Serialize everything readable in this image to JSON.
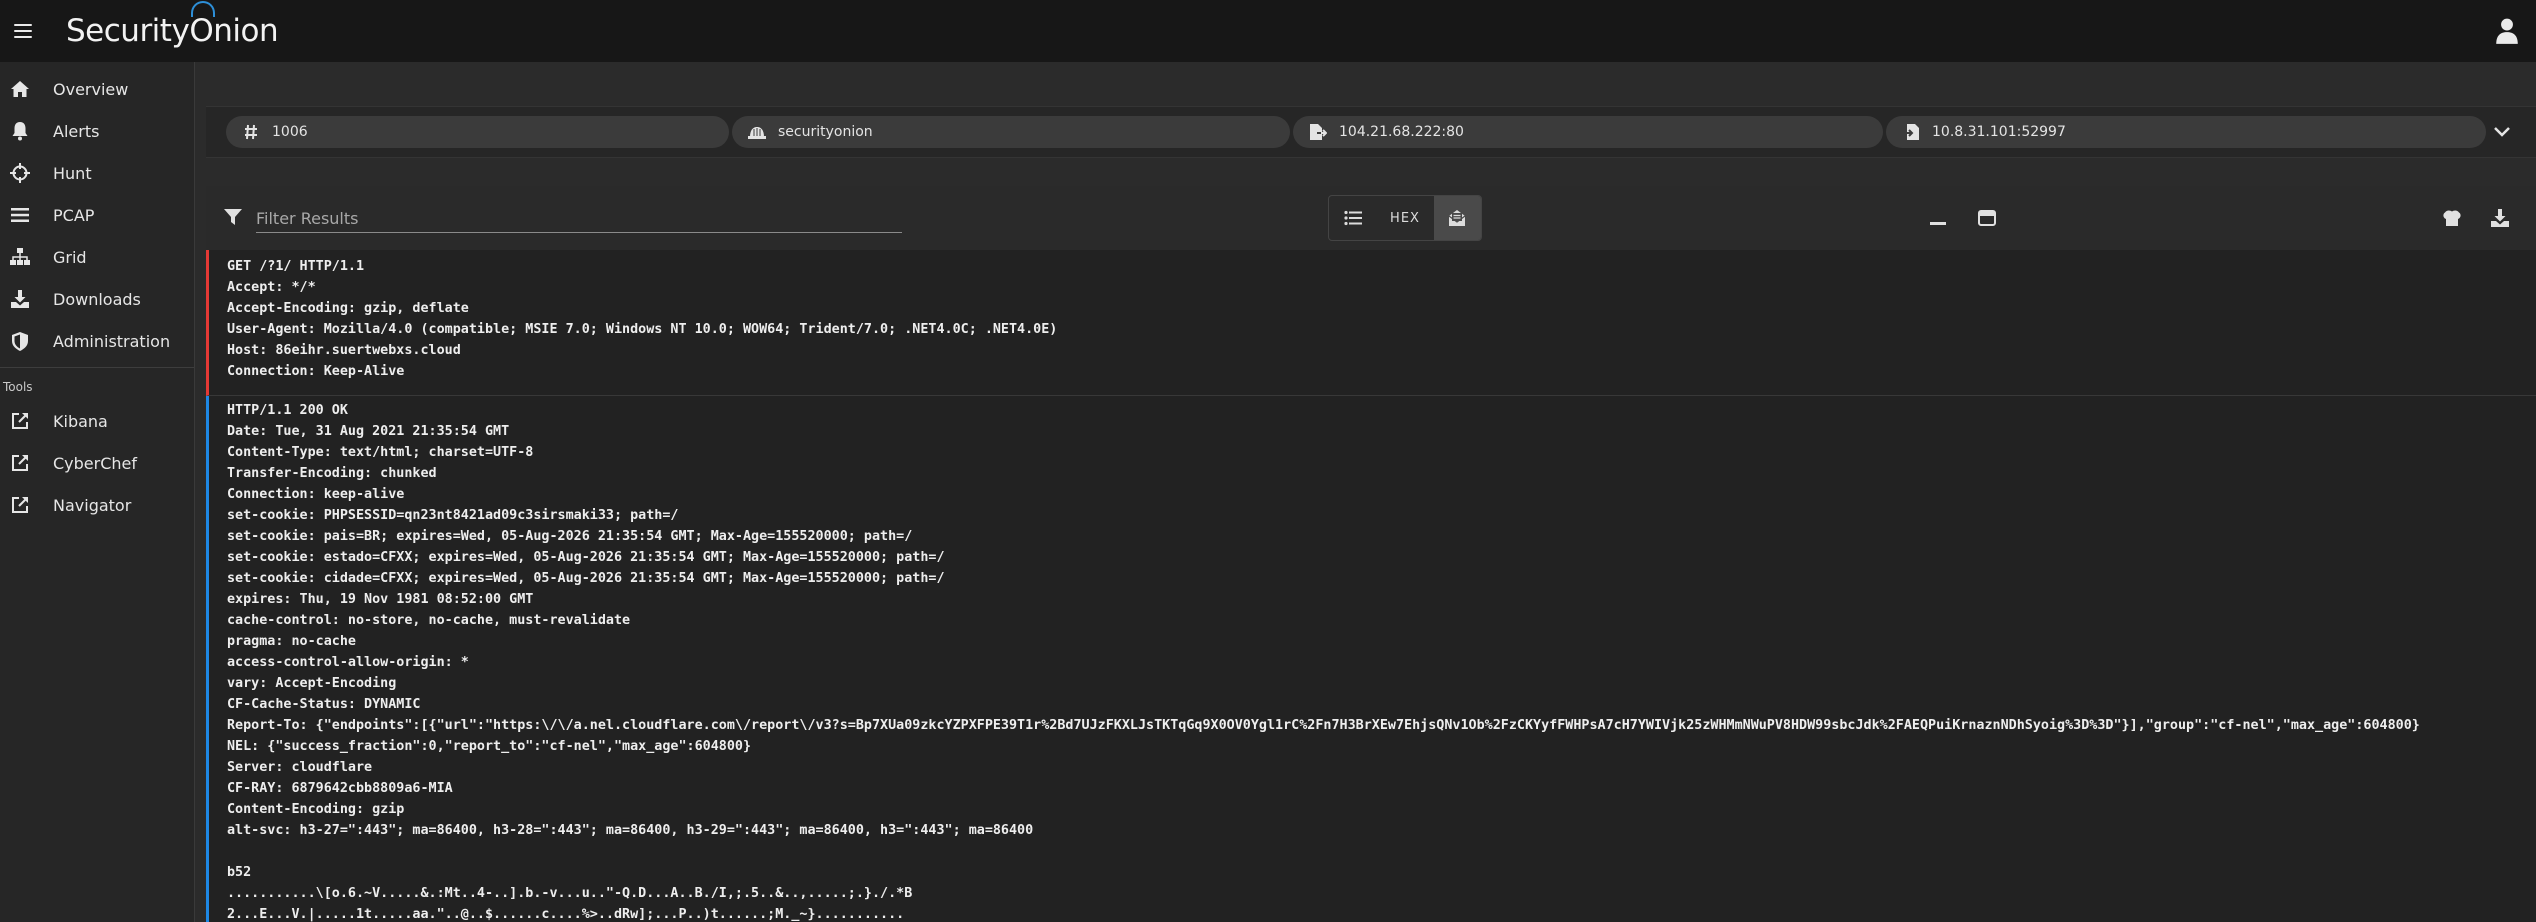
{
  "app": {
    "logo_text_a": "Security",
    "logo_text_o": "O",
    "logo_text_b": "nion"
  },
  "sidebar": {
    "items": [
      {
        "label": "Overview",
        "icon": "home-icon"
      },
      {
        "label": "Alerts",
        "icon": "bell-icon"
      },
      {
        "label": "Hunt",
        "icon": "crosshairs-icon"
      },
      {
        "label": "PCAP",
        "icon": "bars-icon"
      },
      {
        "label": "Grid",
        "icon": "sitemap-icon"
      },
      {
        "label": "Downloads",
        "icon": "download-icon"
      },
      {
        "label": "Administration",
        "icon": "shield-icon"
      }
    ],
    "tools_label": "Tools",
    "tools": [
      {
        "label": "Kibana",
        "icon": "external-link-icon"
      },
      {
        "label": "CyberChef",
        "icon": "external-link-icon"
      },
      {
        "label": "Navigator",
        "icon": "external-link-icon"
      }
    ]
  },
  "filters": {
    "id": "1006",
    "sensor": "securityonion",
    "destination": "104.21.68.222:80",
    "source": "10.8.31.101:52997"
  },
  "toolbar": {
    "filter_placeholder": "Filter Results",
    "hex_label": "HEX"
  },
  "stream": {
    "client_lines": [
      "GET /?1/ HTTP/1.1",
      "Accept: */*",
      "Accept-Encoding: gzip, deflate",
      "User-Agent: Mozilla/4.0 (compatible; MSIE 7.0; Windows NT 10.0; WOW64; Trident/7.0; .NET4.0C; .NET4.0E)",
      "Host: 86eihr.suertwebxs.cloud",
      "Connection: Keep-Alive"
    ],
    "server_lines": [
      "HTTP/1.1 200 OK",
      "Date: Tue, 31 Aug 2021 21:35:54 GMT",
      "Content-Type: text/html; charset=UTF-8",
      "Transfer-Encoding: chunked",
      "Connection: keep-alive",
      "set-cookie: PHPSESSID=qn23nt8421ad09c3sirsmaki33; path=/",
      "set-cookie: pais=BR; expires=Wed, 05-Aug-2026 21:35:54 GMT; Max-Age=155520000; path=/",
      "set-cookie: estado=CFXX; expires=Wed, 05-Aug-2026 21:35:54 GMT; Max-Age=155520000; path=/",
      "set-cookie: cidade=CFXX; expires=Wed, 05-Aug-2026 21:35:54 GMT; Max-Age=155520000; path=/",
      "expires: Thu, 19 Nov 1981 08:52:00 GMT",
      "cache-control: no-store, no-cache, must-revalidate",
      "pragma: no-cache",
      "access-control-allow-origin: *",
      "vary: Accept-Encoding",
      "CF-Cache-Status: DYNAMIC",
      "Report-To: {\"endpoints\":[{\"url\":\"https:\\/\\/a.nel.cloudflare.com\\/report\\/v3?s=Bp7XUa09zkcYZPXFPE39T1r%2Bd7UJzFKXLJsTKTqGq9X0OV0Ygl1rC%2Fn7H3BrXEw7EhjsQNv1Ob%2FzCKYyfFWHPsA7cH7YWIVjk25zWHMmNWuPV8HDW99sbcJdk%2FAEQPuiKrnaznNDhSyoig%3D%3D\"}],\"group\":\"cf-nel\",\"max_age\":604800}",
      "NEL: {\"success_fraction\":0,\"report_to\":\"cf-nel\",\"max_age\":604800}",
      "Server: cloudflare",
      "CF-RAY: 6879642cbb8809a6-MIA",
      "Content-Encoding: gzip",
      "alt-svc: h3-27=\":443\"; ma=86400, h3-28=\":443\"; ma=86400, h3-29=\":443\"; ma=86400, h3=\":443\"; ma=86400",
      "",
      "b52",
      "...........\\[o.6.~V.....&.:Mt..4-..].b.-v...u..\"-Q.D...A..B./I,;.5..&..,.....;.}./.*B",
      "2...E...V.|.....1t.....aa.\"..@..$......c....%>..dRw];...P..)t......;M._~}..........."
    ]
  },
  "colors": {
    "client_accent": "#e53935",
    "server_accent": "#1e88e5",
    "brand_blue": "#2d8fd8"
  }
}
